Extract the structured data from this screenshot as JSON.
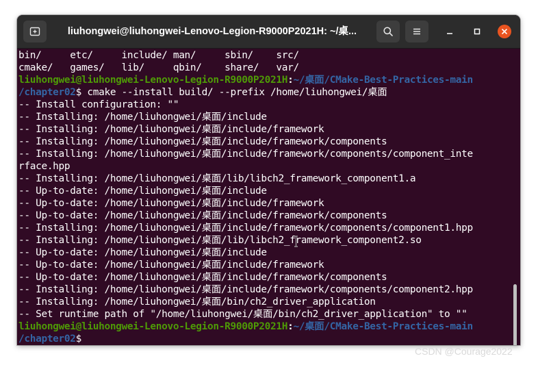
{
  "window": {
    "title": "liuhongwei@liuhongwei-Lenovo-Legion-R9000P2021H: ~/桌..."
  },
  "icons": {
    "new_tab": "new-tab-icon",
    "search": "search-icon",
    "menu": "hamburger-menu-icon",
    "minimize": "minimize-icon",
    "maximize": "maximize-icon",
    "close": "close-icon"
  },
  "colors": {
    "terminal_bg": "#300a24",
    "prompt_user": "#4e9a06",
    "prompt_path": "#3465a4",
    "close_button": "#e95420",
    "text": "#ffffff"
  },
  "terminal": {
    "ls_row_1": "bin/     etc/     include/ man/     sbin/    src/",
    "ls_row_2": "cmake/   games/   lib/     qbin/    share/   var/",
    "prompt_1": {
      "user_host": "liuhongwei@liuhongwei-Lenovo-Legion-R9000P2021H",
      "colon": ":",
      "path_a": "~/桌面/CMake-Best-Practices-main",
      "path_b": "/chapter02",
      "command": "$ cmake --install build/ --prefix /home/liuhongwei/桌面"
    },
    "output": [
      "-- Install configuration: \"\"",
      "-- Installing: /home/liuhongwei/桌面/include",
      "-- Installing: /home/liuhongwei/桌面/include/framework",
      "-- Installing: /home/liuhongwei/桌面/include/framework/components",
      "-- Installing: /home/liuhongwei/桌面/include/framework/components/component_inte",
      "rface.hpp",
      "-- Installing: /home/liuhongwei/桌面/lib/libch2_framework_component1.a",
      "-- Up-to-date: /home/liuhongwei/桌面/include",
      "-- Up-to-date: /home/liuhongwei/桌面/include/framework",
      "-- Up-to-date: /home/liuhongwei/桌面/include/framework/components",
      "-- Installing: /home/liuhongwei/桌面/include/framework/components/component1.hpp",
      "-- Installing: /home/liuhongwei/桌面/lib/libch2_framework_component2.so",
      "-- Up-to-date: /home/liuhongwei/桌面/include",
      "-- Up-to-date: /home/liuhongwei/桌面/include/framework",
      "-- Up-to-date: /home/liuhongwei/桌面/include/framework/components",
      "-- Installing: /home/liuhongwei/桌面/include/framework/components/component2.hpp",
      "-- Installing: /home/liuhongwei/桌面/bin/ch2_driver_application",
      "-- Set runtime path of \"/home/liuhongwei/桌面/bin/ch2_driver_application\" to \"\""
    ],
    "prompt_2": {
      "user_host": "liuhongwei@liuhongwei-Lenovo-Legion-R9000P2021H",
      "colon": ":",
      "path_a": "~/桌面/CMake-Best-Practices-main",
      "path_b": "/chapter02",
      "command": "$"
    }
  },
  "watermark": "CSDN @Courage2022"
}
